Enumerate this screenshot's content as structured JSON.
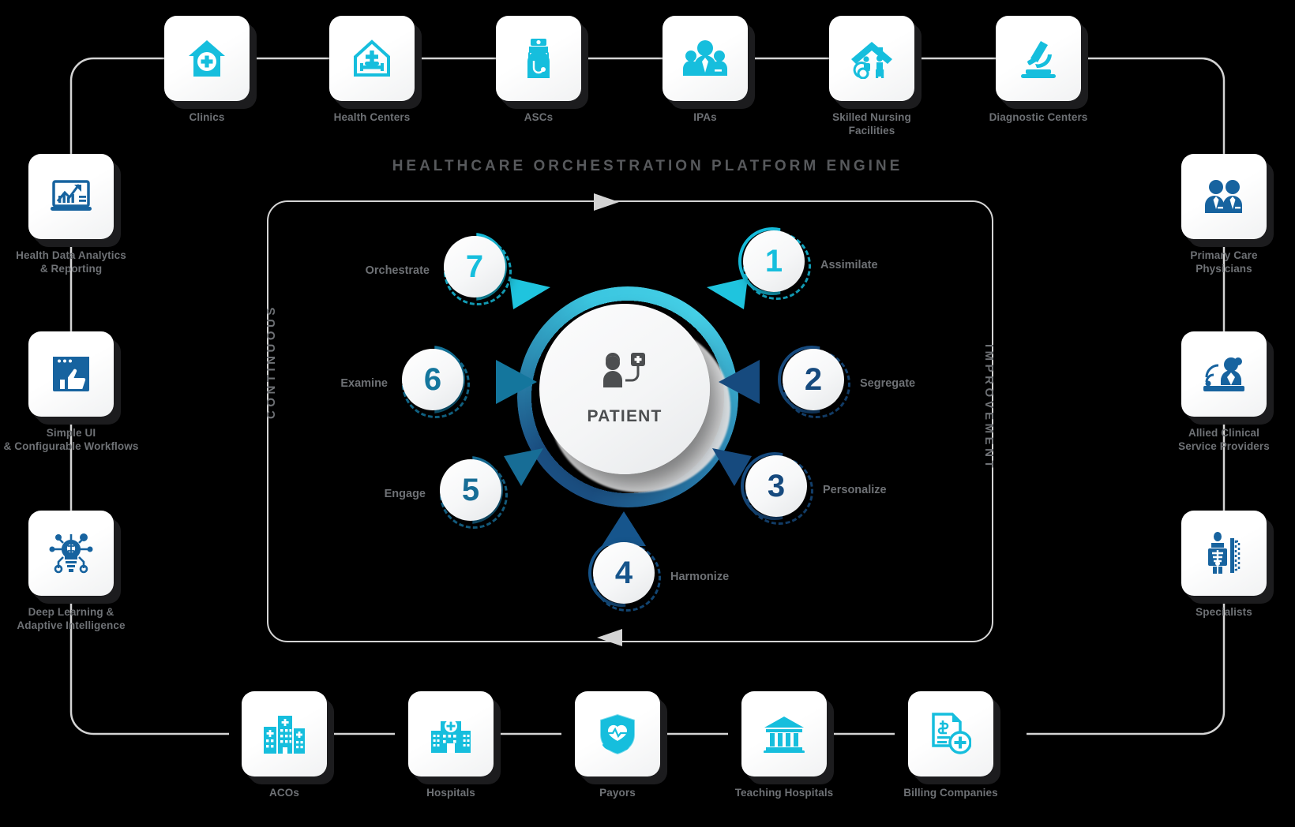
{
  "engine": {
    "title": "HEALTHCARE ORCHESTRATION PLATFORM ENGINE",
    "left_axis_label": "CONTINUOUS",
    "right_axis_label": "IMPROVEMENT"
  },
  "center": {
    "label": "PATIENT",
    "icon": "patient-iv-icon"
  },
  "colors": {
    "cyan": "#16bedd",
    "navy": "#164a7e",
    "teal": "#14769d",
    "steel": "#176d96",
    "label_gray": "#6e7175",
    "card_shadow": "#1c1c1e",
    "wire": "#d4d4d4"
  },
  "steps": [
    {
      "number": "1",
      "label": "Assimilate",
      "color": "#16bedd",
      "label_side": "right"
    },
    {
      "number": "2",
      "label": "Segregate",
      "color": "#164a7e",
      "label_side": "right"
    },
    {
      "number": "3",
      "label": "Personalize",
      "color": "#164a7e",
      "label_side": "right"
    },
    {
      "number": "4",
      "label": "Harmonize",
      "color": "#16558c",
      "label_side": "right"
    },
    {
      "number": "5",
      "label": "Engage",
      "color": "#176d96",
      "label_side": "left"
    },
    {
      "number": "6",
      "label": "Examine",
      "color": "#14769d",
      "label_side": "left"
    },
    {
      "number": "7",
      "label": "Orchestrate",
      "color": "#16bedd",
      "label_side": "left"
    }
  ],
  "top_row": [
    {
      "label": "Clinics",
      "icon": "clinic-house-cross-icon"
    },
    {
      "label": "Health Centers",
      "icon": "health-center-bed-icon"
    },
    {
      "label": "ASCs",
      "icon": "surgeon-icon"
    },
    {
      "label": "IPAs",
      "icon": "physician-group-icon"
    },
    {
      "label": "Skilled Nursing\nFacilities",
      "icon": "nursing-home-icon"
    },
    {
      "label": "Diagnostic Centers",
      "icon": "microscope-icon"
    }
  ],
  "bottom_row": [
    {
      "label": "ACOs",
      "icon": "city-hospitals-icon"
    },
    {
      "label": "Hospitals",
      "icon": "hospital-building-icon"
    },
    {
      "label": "Payors",
      "icon": "shield-heart-hand-icon"
    },
    {
      "label": "Teaching Hospitals",
      "icon": "university-icon"
    },
    {
      "label": "Billing Companies",
      "icon": "invoice-plus-icon"
    }
  ],
  "left_column": [
    {
      "label": "Health Data Analytics\n& Reporting",
      "icon": "analytics-chart-icon"
    },
    {
      "label": "Simple UI\n& Configurable Workflows",
      "icon": "thumbs-up-window-icon"
    },
    {
      "label": "Deep Learning &\nAdaptive Intelligence",
      "icon": "ai-brain-bulb-icon"
    }
  ],
  "right_column": [
    {
      "label": "Primary Care\nPhysicians",
      "icon": "doctors-pair-icon"
    },
    {
      "label": "Allied Clinical\nService Providers",
      "icon": "telehealth-nurse-icon"
    },
    {
      "label": "Specialists",
      "icon": "xray-icon"
    }
  ]
}
